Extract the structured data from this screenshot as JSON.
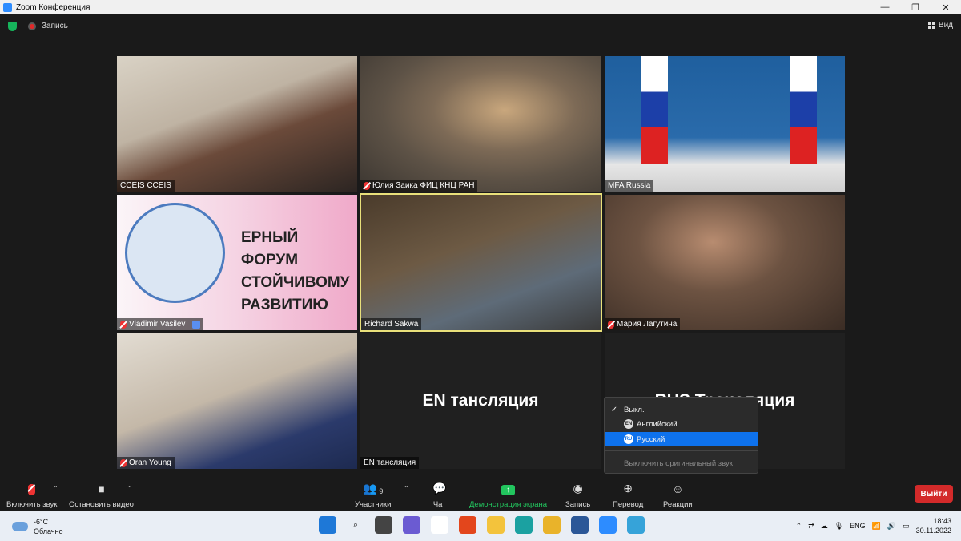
{
  "window": {
    "title": "Zoom Конференция",
    "controls": [
      "—",
      "❐",
      "✕"
    ]
  },
  "topbar": {
    "record_label": "Запись",
    "view_label": "Вид"
  },
  "tiles": [
    {
      "name": "CCEIS CCEIS",
      "muted": false
    },
    {
      "name": "Юлия Заика ФИЦ КНЦ РАН",
      "muted": true
    },
    {
      "name": "MFA Russia",
      "muted": false
    },
    {
      "name": "Vladimir Vasilev",
      "muted": true
    },
    {
      "name": "Richard Sakwa",
      "muted": false
    },
    {
      "name": "Мария Лагутина",
      "muted": true
    },
    {
      "name": "Oran Young",
      "muted": true
    },
    {
      "name": "EN тансляция",
      "muted": false
    },
    {
      "name": "",
      "muted": false
    }
  ],
  "stream_titles": {
    "en": "EN тансляция",
    "ru": "RUS Трансляция"
  },
  "forum_banner": {
    "lines": [
      "ЕРНЫЙ ФОРУМ",
      "СТОЙЧИВОМУ",
      "РАЗВИТИЮ"
    ]
  },
  "interpretation_menu": {
    "off": "Выкл.",
    "english": {
      "badge": "EN",
      "label": "Английский"
    },
    "russian": {
      "badge": "RU",
      "label": "Русский"
    },
    "mute_original": "Выключить оригинальный звук"
  },
  "toolbar": {
    "unmute": "Включить звук",
    "stop_video": "Остановить видео",
    "participants": "Участники",
    "participants_count": "9",
    "chat": "Чат",
    "share": "Демонстрация экрана",
    "record": "Запись",
    "translate": "Перевод",
    "reactions": "Реакции",
    "leave": "Выйти"
  },
  "taskbar": {
    "temperature": "-6°C",
    "weather": "Облачно",
    "language": "ENG",
    "time": "18:43",
    "date": "30.11.2022"
  }
}
